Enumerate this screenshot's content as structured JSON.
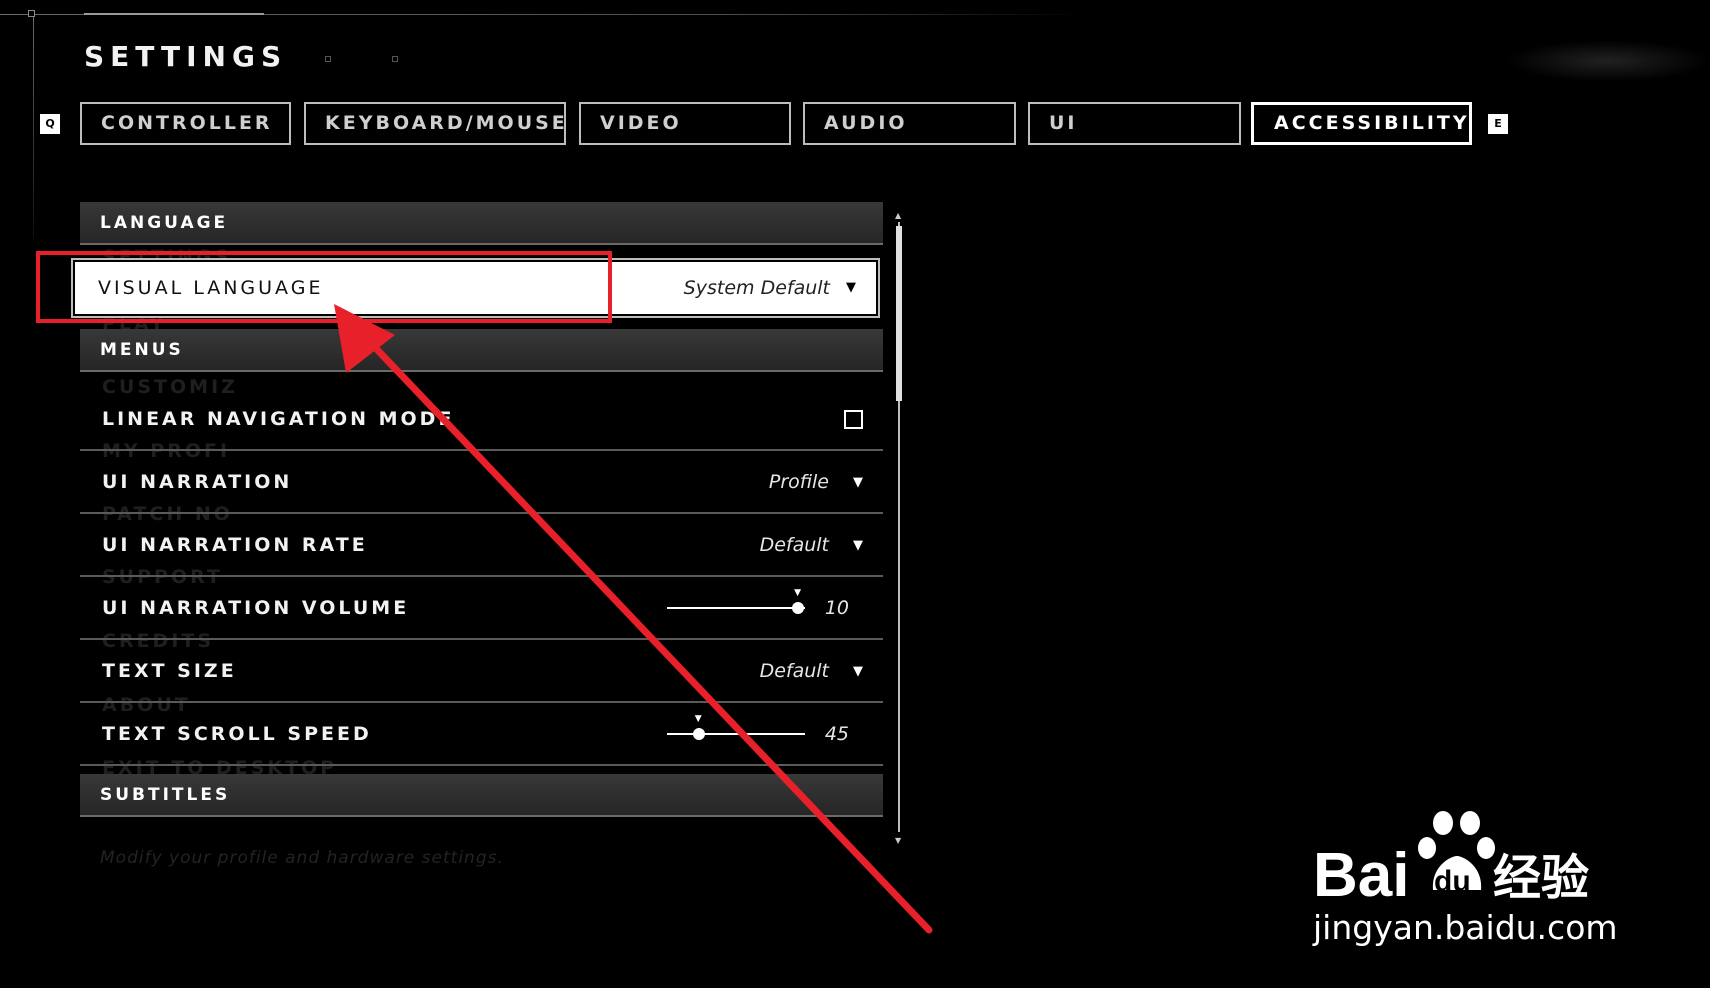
{
  "header": {
    "title": "SETTINGS",
    "left_key": "Q",
    "right_key": "E"
  },
  "tabs": [
    {
      "label": "CONTROLLER",
      "active": false
    },
    {
      "label": "KEYBOARD/MOUSE",
      "active": false
    },
    {
      "label": "VIDEO",
      "active": false
    },
    {
      "label": "AUDIO",
      "active": false
    },
    {
      "label": "UI",
      "active": false
    },
    {
      "label": "ACCESSIBILITY",
      "active": true
    }
  ],
  "sections": {
    "language": "LANGUAGE",
    "menus": "MENUS",
    "subtitles": "SUBTITLES"
  },
  "settings": {
    "visual_language": {
      "label": "VISUAL LANGUAGE",
      "value": "System Default"
    },
    "linear_navigation": {
      "label": "LINEAR NAVIGATION MODE",
      "checked": false
    },
    "ui_narration": {
      "label": "UI NARRATION",
      "value": "Profile"
    },
    "ui_narration_rate": {
      "label": "UI NARRATION RATE",
      "value": "Default"
    },
    "ui_narration_volume": {
      "label": "UI NARRATION VOLUME",
      "value": "10",
      "fraction": 0.95
    },
    "text_size": {
      "label": "TEXT SIZE",
      "value": "Default"
    },
    "text_scroll_speed": {
      "label": "TEXT SCROLL SPEED",
      "value": "45",
      "fraction": 0.23
    }
  },
  "background_menu": [
    "SETTINGS",
    "PLAY",
    "CUSTOMIZ",
    "MY PROFI",
    "PATCH NO",
    "SUPPORT",
    "CREDITS",
    "ABOUT",
    "EXIT TO DESKTOP"
  ],
  "footer_hint": "Modify your profile and hardware settings.",
  "annotation": {
    "color": "#e8202a"
  },
  "watermark": {
    "logo_text": "Bai",
    "logo_du": "du",
    "logo_cn": "经验",
    "url": "jingyan.baidu.com"
  }
}
